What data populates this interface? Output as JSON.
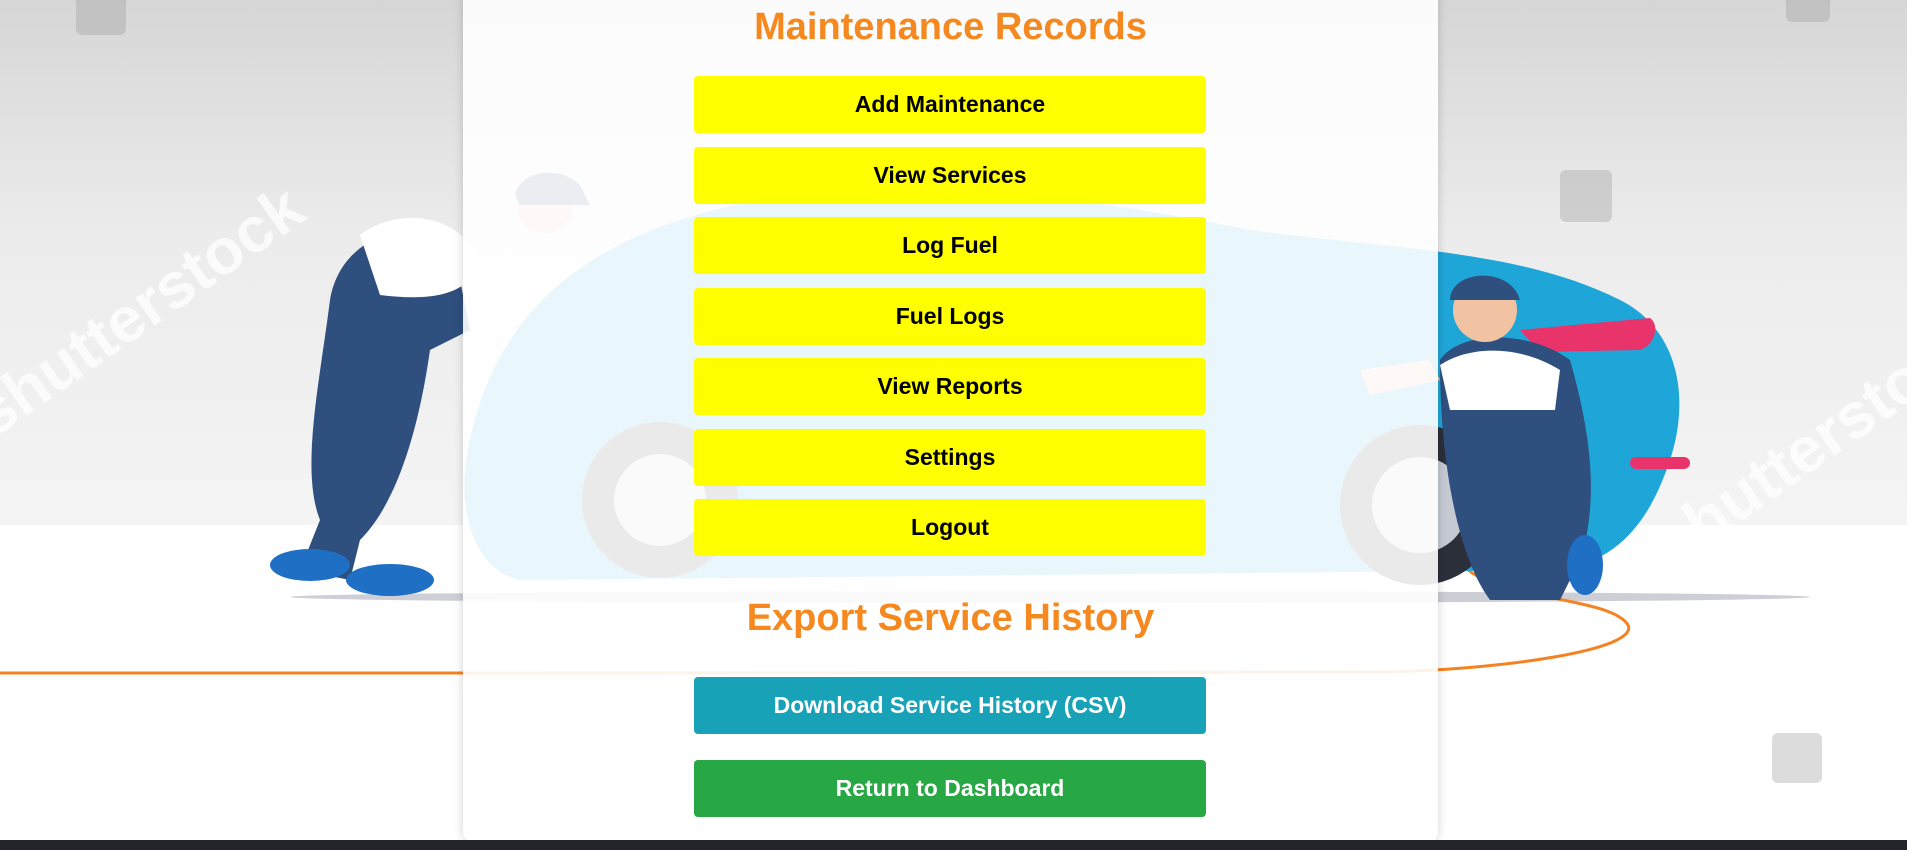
{
  "maintenance": {
    "title": "Maintenance Records",
    "buttons": [
      "Add Maintenance",
      "View Services",
      "Log Fuel",
      "Fuel Logs",
      "View Reports",
      "Settings",
      "Logout"
    ]
  },
  "export": {
    "title": "Export Service History",
    "download_label": "Download Service History (CSV)",
    "return_label": "Return to Dashboard"
  },
  "background": {
    "watermark_text": "shutterstock",
    "accent_color": "#f5891f",
    "primary_button_color": "#ffff00",
    "download_button_color": "#17a2b8",
    "return_button_color": "#28a745"
  }
}
